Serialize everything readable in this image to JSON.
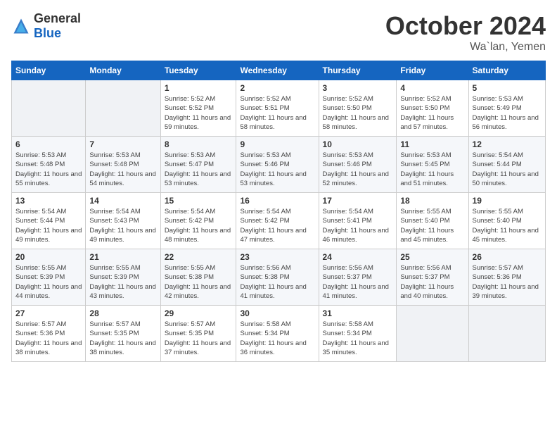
{
  "logo": {
    "general": "General",
    "blue": "Blue"
  },
  "header": {
    "month": "October 2024",
    "location": "Wa`lan, Yemen"
  },
  "weekdays": [
    "Sunday",
    "Monday",
    "Tuesday",
    "Wednesday",
    "Thursday",
    "Friday",
    "Saturday"
  ],
  "weeks": [
    [
      {
        "day": "",
        "sunrise": "",
        "sunset": "",
        "daylight": ""
      },
      {
        "day": "",
        "sunrise": "",
        "sunset": "",
        "daylight": ""
      },
      {
        "day": "1",
        "sunrise": "Sunrise: 5:52 AM",
        "sunset": "Sunset: 5:52 PM",
        "daylight": "Daylight: 11 hours and 59 minutes."
      },
      {
        "day": "2",
        "sunrise": "Sunrise: 5:52 AM",
        "sunset": "Sunset: 5:51 PM",
        "daylight": "Daylight: 11 hours and 58 minutes."
      },
      {
        "day": "3",
        "sunrise": "Sunrise: 5:52 AM",
        "sunset": "Sunset: 5:50 PM",
        "daylight": "Daylight: 11 hours and 58 minutes."
      },
      {
        "day": "4",
        "sunrise": "Sunrise: 5:52 AM",
        "sunset": "Sunset: 5:50 PM",
        "daylight": "Daylight: 11 hours and 57 minutes."
      },
      {
        "day": "5",
        "sunrise": "Sunrise: 5:53 AM",
        "sunset": "Sunset: 5:49 PM",
        "daylight": "Daylight: 11 hours and 56 minutes."
      }
    ],
    [
      {
        "day": "6",
        "sunrise": "Sunrise: 5:53 AM",
        "sunset": "Sunset: 5:48 PM",
        "daylight": "Daylight: 11 hours and 55 minutes."
      },
      {
        "day": "7",
        "sunrise": "Sunrise: 5:53 AM",
        "sunset": "Sunset: 5:48 PM",
        "daylight": "Daylight: 11 hours and 54 minutes."
      },
      {
        "day": "8",
        "sunrise": "Sunrise: 5:53 AM",
        "sunset": "Sunset: 5:47 PM",
        "daylight": "Daylight: 11 hours and 53 minutes."
      },
      {
        "day": "9",
        "sunrise": "Sunrise: 5:53 AM",
        "sunset": "Sunset: 5:46 PM",
        "daylight": "Daylight: 11 hours and 53 minutes."
      },
      {
        "day": "10",
        "sunrise": "Sunrise: 5:53 AM",
        "sunset": "Sunset: 5:46 PM",
        "daylight": "Daylight: 11 hours and 52 minutes."
      },
      {
        "day": "11",
        "sunrise": "Sunrise: 5:53 AM",
        "sunset": "Sunset: 5:45 PM",
        "daylight": "Daylight: 11 hours and 51 minutes."
      },
      {
        "day": "12",
        "sunrise": "Sunrise: 5:54 AM",
        "sunset": "Sunset: 5:44 PM",
        "daylight": "Daylight: 11 hours and 50 minutes."
      }
    ],
    [
      {
        "day": "13",
        "sunrise": "Sunrise: 5:54 AM",
        "sunset": "Sunset: 5:44 PM",
        "daylight": "Daylight: 11 hours and 49 minutes."
      },
      {
        "day": "14",
        "sunrise": "Sunrise: 5:54 AM",
        "sunset": "Sunset: 5:43 PM",
        "daylight": "Daylight: 11 hours and 49 minutes."
      },
      {
        "day": "15",
        "sunrise": "Sunrise: 5:54 AM",
        "sunset": "Sunset: 5:42 PM",
        "daylight": "Daylight: 11 hours and 48 minutes."
      },
      {
        "day": "16",
        "sunrise": "Sunrise: 5:54 AM",
        "sunset": "Sunset: 5:42 PM",
        "daylight": "Daylight: 11 hours and 47 minutes."
      },
      {
        "day": "17",
        "sunrise": "Sunrise: 5:54 AM",
        "sunset": "Sunset: 5:41 PM",
        "daylight": "Daylight: 11 hours and 46 minutes."
      },
      {
        "day": "18",
        "sunrise": "Sunrise: 5:55 AM",
        "sunset": "Sunset: 5:40 PM",
        "daylight": "Daylight: 11 hours and 45 minutes."
      },
      {
        "day": "19",
        "sunrise": "Sunrise: 5:55 AM",
        "sunset": "Sunset: 5:40 PM",
        "daylight": "Daylight: 11 hours and 45 minutes."
      }
    ],
    [
      {
        "day": "20",
        "sunrise": "Sunrise: 5:55 AM",
        "sunset": "Sunset: 5:39 PM",
        "daylight": "Daylight: 11 hours and 44 minutes."
      },
      {
        "day": "21",
        "sunrise": "Sunrise: 5:55 AM",
        "sunset": "Sunset: 5:39 PM",
        "daylight": "Daylight: 11 hours and 43 minutes."
      },
      {
        "day": "22",
        "sunrise": "Sunrise: 5:55 AM",
        "sunset": "Sunset: 5:38 PM",
        "daylight": "Daylight: 11 hours and 42 minutes."
      },
      {
        "day": "23",
        "sunrise": "Sunrise: 5:56 AM",
        "sunset": "Sunset: 5:38 PM",
        "daylight": "Daylight: 11 hours and 41 minutes."
      },
      {
        "day": "24",
        "sunrise": "Sunrise: 5:56 AM",
        "sunset": "Sunset: 5:37 PM",
        "daylight": "Daylight: 11 hours and 41 minutes."
      },
      {
        "day": "25",
        "sunrise": "Sunrise: 5:56 AM",
        "sunset": "Sunset: 5:37 PM",
        "daylight": "Daylight: 11 hours and 40 minutes."
      },
      {
        "day": "26",
        "sunrise": "Sunrise: 5:57 AM",
        "sunset": "Sunset: 5:36 PM",
        "daylight": "Daylight: 11 hours and 39 minutes."
      }
    ],
    [
      {
        "day": "27",
        "sunrise": "Sunrise: 5:57 AM",
        "sunset": "Sunset: 5:36 PM",
        "daylight": "Daylight: 11 hours and 38 minutes."
      },
      {
        "day": "28",
        "sunrise": "Sunrise: 5:57 AM",
        "sunset": "Sunset: 5:35 PM",
        "daylight": "Daylight: 11 hours and 38 minutes."
      },
      {
        "day": "29",
        "sunrise": "Sunrise: 5:57 AM",
        "sunset": "Sunset: 5:35 PM",
        "daylight": "Daylight: 11 hours and 37 minutes."
      },
      {
        "day": "30",
        "sunrise": "Sunrise: 5:58 AM",
        "sunset": "Sunset: 5:34 PM",
        "daylight": "Daylight: 11 hours and 36 minutes."
      },
      {
        "day": "31",
        "sunrise": "Sunrise: 5:58 AM",
        "sunset": "Sunset: 5:34 PM",
        "daylight": "Daylight: 11 hours and 35 minutes."
      },
      {
        "day": "",
        "sunrise": "",
        "sunset": "",
        "daylight": ""
      },
      {
        "day": "",
        "sunrise": "",
        "sunset": "",
        "daylight": ""
      }
    ]
  ]
}
